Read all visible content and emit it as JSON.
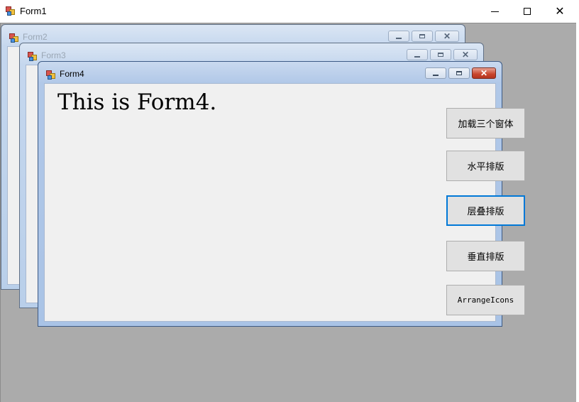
{
  "main_window": {
    "title": "Form1",
    "controls": {
      "minimize": "minimize",
      "maximize": "maximize",
      "close": "✕"
    }
  },
  "child_forms": [
    {
      "title": "Form2",
      "active": false
    },
    {
      "title": "Form3",
      "active": false
    },
    {
      "title": "Form4",
      "active": true
    }
  ],
  "form4": {
    "content_text": "This is Form4."
  },
  "side_buttons": [
    {
      "label": "加载三个窗体"
    },
    {
      "label": "水平排版"
    },
    {
      "label": "层叠排版",
      "focused": true
    },
    {
      "label": "垂直排版"
    },
    {
      "label": "ArrangeIcons"
    }
  ],
  "colors": {
    "mdi_background": "#ababab",
    "child_client": "#f0f0f0",
    "focus_border": "#0078d7",
    "close_red": "#c8452d"
  },
  "icons": [
    "app-icon",
    "minimize-icon",
    "maximize-icon",
    "close-icon"
  ]
}
